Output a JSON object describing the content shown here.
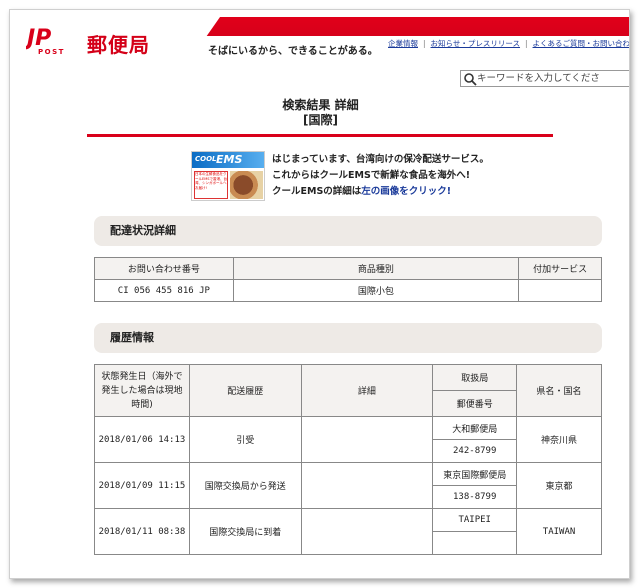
{
  "header": {
    "logo_mark": "JP",
    "logo_post": "POST",
    "logo_text": "郵便局",
    "tagline": "そばにいるから、できることがある。",
    "links": [
      "企業情報",
      "お知らせ・プレスリリース",
      "よくあるご質問・お問い合わ"
    ],
    "search_placeholder": "キーワードを入力してくださ",
    "colors": {
      "brand_red": "#d9001a",
      "link_blue": "#1a3a9a"
    }
  },
  "title": {
    "line1": "検索結果 詳細",
    "line2": "[国際]"
  },
  "ems_banner": {
    "cool_label": "COOL",
    "ems_label": "EMS",
    "side_text": "日本の生鮮食品をクールEMSで香港、台湾、シンガポールへお届け!",
    "line1": "はじまっています、台湾向けの保冷配送サービス。",
    "line2": "これからはクールEMSで新鮮な食品を海外へ!",
    "line3_prefix": "クールEMSの詳細は",
    "line3_link": "左の画像をクリック!"
  },
  "delivery_status": {
    "heading": "配達状況詳細",
    "columns": [
      "お問い合わせ番号",
      "商品種別",
      "付加サービス"
    ],
    "row": [
      "CI 056 455 816 JP",
      "国際小包",
      ""
    ]
  },
  "history": {
    "heading": "履歴情報",
    "columns": {
      "date": "状態発生日（海外で発生した場合は現地時間)",
      "event": "配送履歴",
      "detail": "詳細",
      "office": "取扱局",
      "postcode": "郵便番号",
      "region": "県名・国名"
    },
    "rows": [
      {
        "date": "2018/01/06 14:13",
        "event": "引受",
        "detail": "",
        "office": "大和郵便局",
        "postcode": "242-8799",
        "region": "神奈川県"
      },
      {
        "date": "2018/01/09 11:15",
        "event": "国際交換局から発送",
        "detail": "",
        "office": "東京国際郵便局",
        "postcode": "138-8799",
        "region": "東京都"
      },
      {
        "date": "2018/01/11 08:38",
        "event": "国際交換局に到着",
        "detail": "",
        "office": "TAIPEI",
        "postcode": "",
        "region": "TAIWAN"
      }
    ]
  }
}
